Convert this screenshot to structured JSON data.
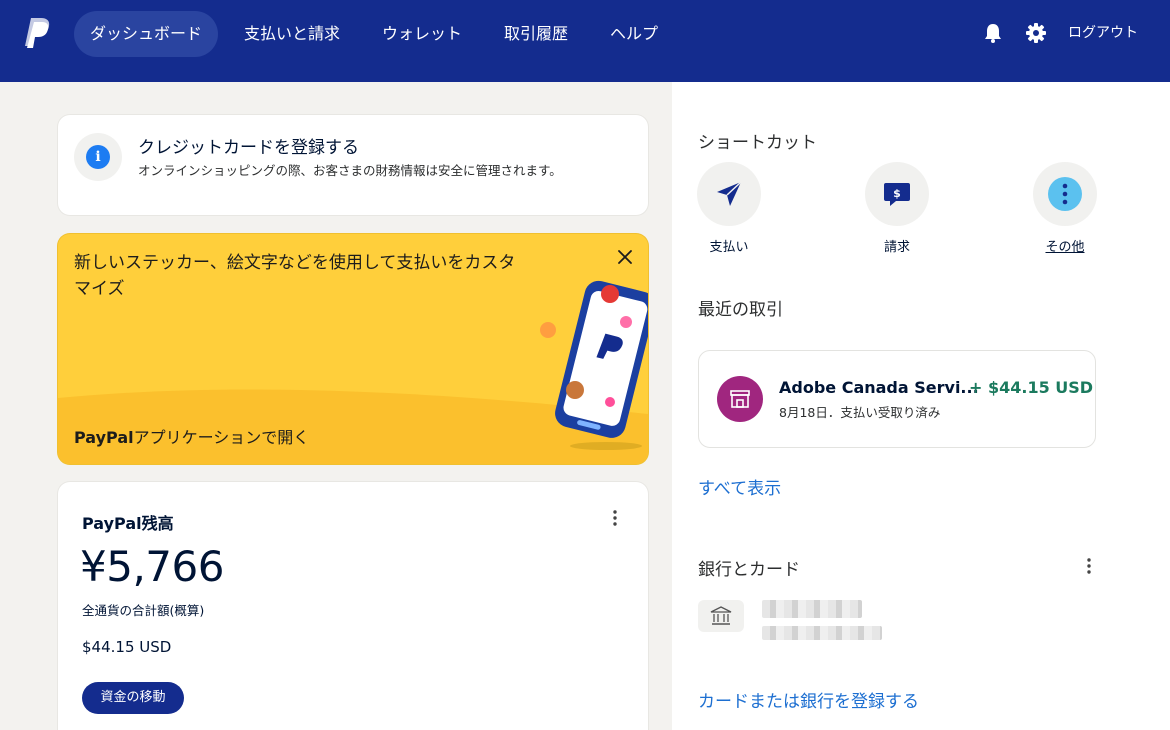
{
  "nav": {
    "logo": "paypal-logo",
    "items": [
      {
        "label": "ダッシュボード",
        "active": true
      },
      {
        "label": "支払いと請求",
        "active": false
      },
      {
        "label": "ウォレット",
        "active": false
      },
      {
        "label": "取引履歴",
        "active": false
      },
      {
        "label": "ヘルプ",
        "active": false
      }
    ],
    "icons": [
      "bell-icon",
      "gear-icon"
    ],
    "logout": "ログアウト"
  },
  "info_card": {
    "title": "クレジットカードを登録する",
    "description": "オンラインショッピングの際、お客さまの財務情報は安全に管理されます。",
    "icon": "info-icon"
  },
  "promo": {
    "text": "新しいステッカー、絵文字などを使用して支払いをカスタマイズ",
    "link_brand": "PayPal",
    "link_rest": "アプリケーションで開く",
    "close_icon": "close-icon"
  },
  "balance": {
    "title": "PayPal残高",
    "amount": "¥5,766",
    "subtitle": "全通貨の合計額(概算)",
    "usd": "$44.15 USD",
    "button": "資金の移動"
  },
  "shortcuts": {
    "title": "ショートカット",
    "items": [
      {
        "label": "支払い",
        "icon": "send-icon"
      },
      {
        "label": "請求",
        "icon": "request-icon"
      },
      {
        "label": "その他",
        "icon": "more-icon"
      }
    ]
  },
  "recent": {
    "title": "最近の取引",
    "transactions": [
      {
        "name": "Adobe Canada Servi...",
        "amount": "+ $44.15 USD",
        "meta": "8月18日．支払い受取り済み",
        "icon": "store-icon"
      }
    ],
    "view_all": "すべて表示"
  },
  "banks": {
    "title": "銀行とカード",
    "icon": "bank-icon",
    "add_link": "カードまたは銀行を登録する"
  },
  "colors": {
    "nav_bg": "#142c8e",
    "left_bg": "#f3f2ef",
    "promo_bg": "#ffcf3b",
    "link": "#1d6fd1",
    "positive": "#1b7a5e"
  }
}
